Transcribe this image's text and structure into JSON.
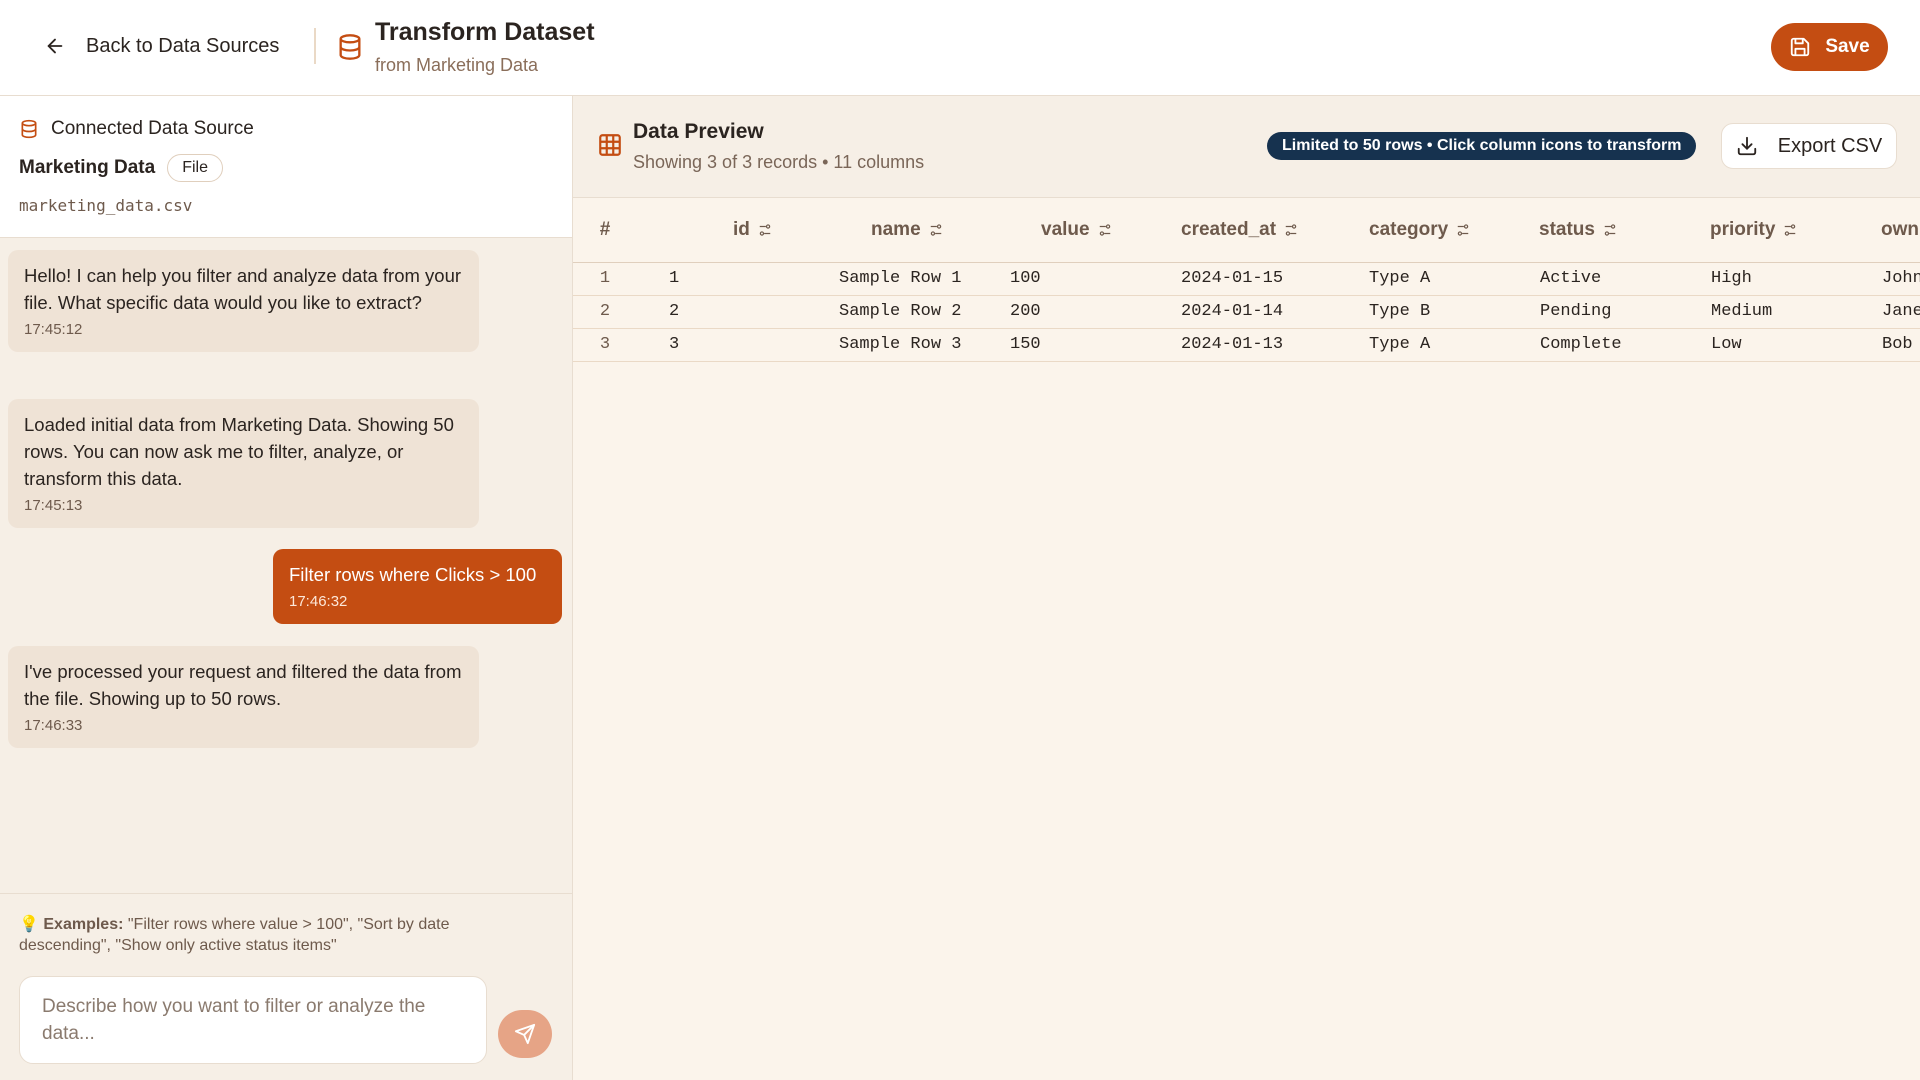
{
  "header": {
    "back_label": "Back to Data Sources",
    "title": "Transform Dataset",
    "subtitle": "from Marketing Data",
    "save_label": "Save"
  },
  "source": {
    "heading": "Connected Data Source",
    "name": "Marketing Data",
    "type_badge": "File",
    "path": "marketing_data.csv"
  },
  "chat": {
    "messages": [
      {
        "role": "bot",
        "text": "Hello! I can help you filter and analyze data from your file. What specific data would you like to extract?",
        "time": "17:45:12"
      },
      {
        "role": "bot",
        "text": "Loaded initial data from Marketing Data. Showing 50 rows. You can now ask me to filter, analyze, or transform this data.",
        "time": "17:45:13"
      },
      {
        "role": "user",
        "text": "Filter rows where Clicks > 100",
        "time": "17:46:32"
      },
      {
        "role": "bot",
        "text": "I've processed your request and filtered the data from the file. Showing up to 50 rows.",
        "time": "17:46:33"
      }
    ]
  },
  "composer": {
    "examples_label": "Examples:",
    "examples_text": "\"Filter rows where value > 100\", \"Sort by date descending\", \"Show only active status items\"",
    "placeholder": "Describe how you want to filter or analyze the data..."
  },
  "preview": {
    "title": "Data Preview",
    "subtitle": "Showing 3 of 3 records • 11 columns",
    "limit_badge": "Limited to 50 rows • Click column icons to transform",
    "export_label": "Export CSV",
    "columns": [
      "#",
      "id",
      "name",
      "value",
      "created_at",
      "category",
      "status",
      "priority",
      "own"
    ],
    "rows": [
      [
        "1",
        "1",
        "Sample Row 1",
        "100",
        "2024-01-15",
        "Type A",
        "Active",
        "High",
        "John"
      ],
      [
        "2",
        "2",
        "Sample Row 2",
        "200",
        "2024-01-14",
        "Type B",
        "Pending",
        "Medium",
        "Jane"
      ],
      [
        "3",
        "3",
        "Sample Row 3",
        "150",
        "2024-01-13",
        "Type A",
        "Complete",
        "Low",
        "Bob"
      ]
    ]
  },
  "colors": {
    "accent": "#c44d12",
    "badge_dark": "#16324f",
    "panel_bg": "#f6efe6"
  }
}
